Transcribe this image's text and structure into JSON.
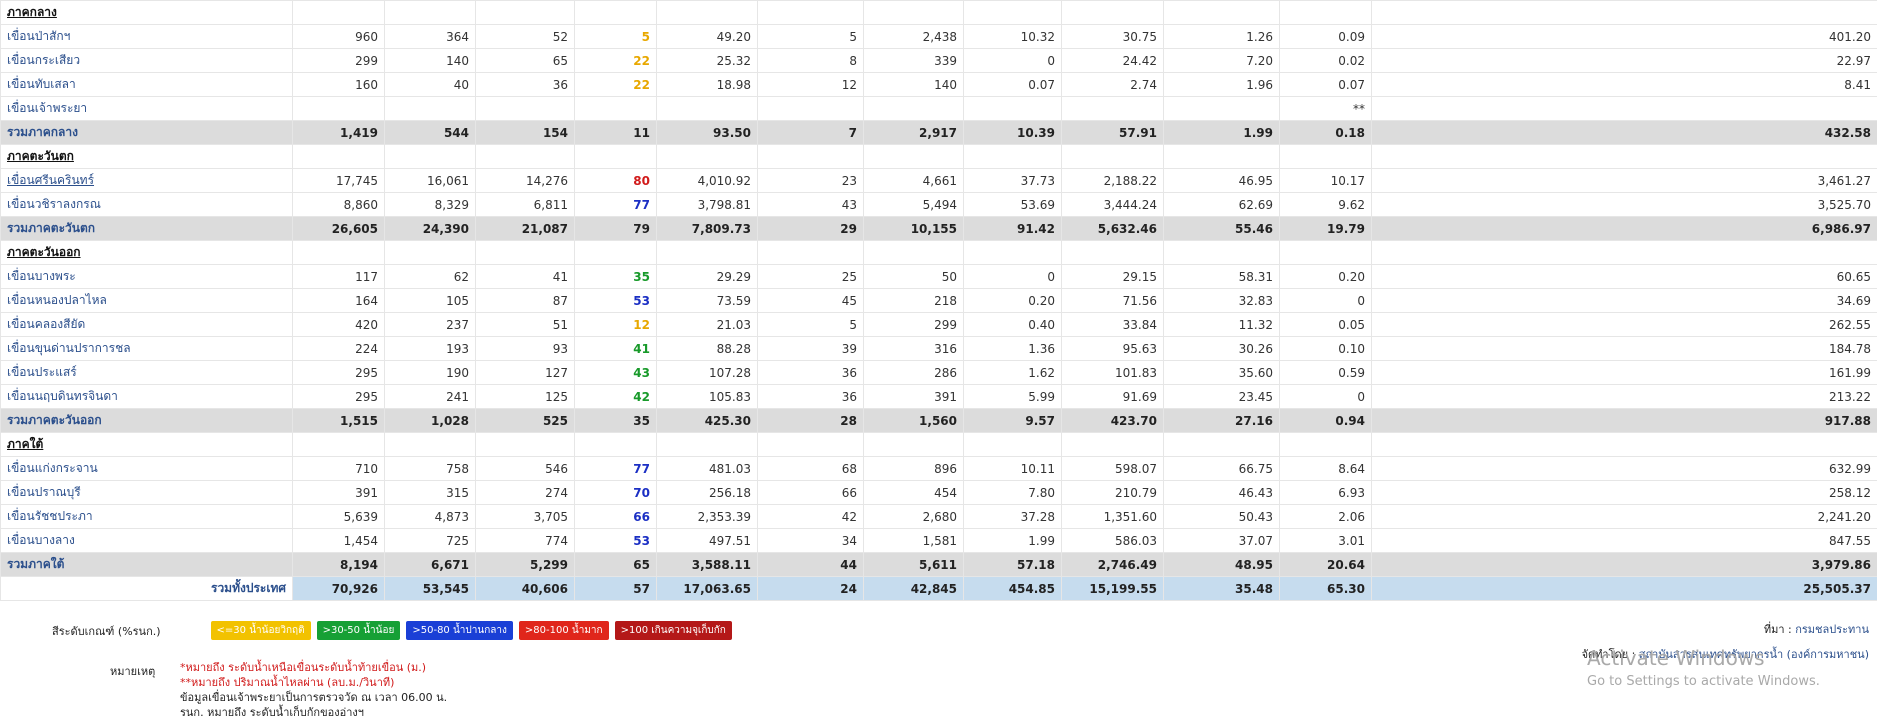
{
  "rows": [
    {
      "type": "region",
      "name": "ภาคกลาง"
    },
    {
      "type": "dam",
      "name": "เขื่อนป่าสักฯ",
      "c": [
        "960",
        "364",
        "52",
        "5",
        "49.20",
        "5",
        "2,438",
        "10.32",
        "30.75",
        "1.26",
        "0.09",
        "401.20"
      ],
      "pc": "yellow"
    },
    {
      "type": "dam",
      "name": "เขื่อนกระเสียว",
      "c": [
        "299",
        "140",
        "65",
        "22",
        "25.32",
        "8",
        "339",
        "0",
        "24.42",
        "7.20",
        "0.02",
        "22.97"
      ],
      "pc": "yellow"
    },
    {
      "type": "dam",
      "name": "เขื่อนทับเสลา",
      "c": [
        "160",
        "40",
        "36",
        "22",
        "18.98",
        "12",
        "140",
        "0.07",
        "2.74",
        "1.96",
        "0.07",
        "8.41"
      ],
      "pc": "yellow"
    },
    {
      "type": "dam",
      "name": "เขื่อนเจ้าพระยา",
      "c": [
        "",
        "",
        "",
        "",
        "",
        "",
        "",
        "",
        "",
        "",
        "**",
        ""
      ],
      "pc": "",
      "star": true
    },
    {
      "type": "total",
      "name": "รวมภาคกลาง",
      "c": [
        "1,419",
        "544",
        "154",
        "11",
        "93.50",
        "7",
        "2,917",
        "10.39",
        "57.91",
        "1.99",
        "0.18",
        "432.58"
      ]
    },
    {
      "type": "region",
      "name": "ภาคตะวันตก"
    },
    {
      "type": "dam",
      "name": "เขื่อนศรีนครินทร์",
      "c": [
        "17,745",
        "16,061",
        "14,276",
        "80",
        "4,010.92",
        "23",
        "4,661",
        "37.73",
        "2,188.22",
        "46.95",
        "10.17",
        "3,461.27"
      ],
      "pc": "red",
      "ul": true
    },
    {
      "type": "dam",
      "name": "เขื่อนวชิราลงกรณ",
      "c": [
        "8,860",
        "8,329",
        "6,811",
        "77",
        "3,798.81",
        "43",
        "5,494",
        "53.69",
        "3,444.24",
        "62.69",
        "9.62",
        "3,525.70"
      ],
      "pc": "blue"
    },
    {
      "type": "total",
      "name": "รวมภาคตะวันตก",
      "c": [
        "26,605",
        "24,390",
        "21,087",
        "79",
        "7,809.73",
        "29",
        "10,155",
        "91.42",
        "5,632.46",
        "55.46",
        "19.79",
        "6,986.97"
      ]
    },
    {
      "type": "region",
      "name": "ภาคตะวันออก"
    },
    {
      "type": "dam",
      "name": "เขื่อนบางพระ",
      "c": [
        "117",
        "62",
        "41",
        "35",
        "29.29",
        "25",
        "50",
        "0",
        "29.15",
        "58.31",
        "0.20",
        "60.65"
      ],
      "pc": "green"
    },
    {
      "type": "dam",
      "name": "เขื่อนหนองปลาไหล",
      "c": [
        "164",
        "105",
        "87",
        "53",
        "73.59",
        "45",
        "218",
        "0.20",
        "71.56",
        "32.83",
        "0",
        "34.69"
      ],
      "pc": "blue"
    },
    {
      "type": "dam",
      "name": "เขื่อนคลองสียัด",
      "c": [
        "420",
        "237",
        "51",
        "12",
        "21.03",
        "5",
        "299",
        "0.40",
        "33.84",
        "11.32",
        "0.05",
        "262.55"
      ],
      "pc": "yellow"
    },
    {
      "type": "dam",
      "name": "เขื่อนขุนด่านปราการชล",
      "c": [
        "224",
        "193",
        "93",
        "41",
        "88.28",
        "39",
        "316",
        "1.36",
        "95.63",
        "30.26",
        "0.10",
        "184.78"
      ],
      "pc": "green"
    },
    {
      "type": "dam",
      "name": "เขื่อนประแสร์",
      "c": [
        "295",
        "190",
        "127",
        "43",
        "107.28",
        "36",
        "286",
        "1.62",
        "101.83",
        "35.60",
        "0.59",
        "161.99"
      ],
      "pc": "green"
    },
    {
      "type": "dam",
      "name": "เขื่อนนฤบดินทรจินดา",
      "c": [
        "295",
        "241",
        "125",
        "42",
        "105.83",
        "36",
        "391",
        "5.99",
        "91.69",
        "23.45",
        "0",
        "213.22"
      ],
      "pc": "green"
    },
    {
      "type": "total",
      "name": "รวมภาคตะวันออก",
      "c": [
        "1,515",
        "1,028",
        "525",
        "35",
        "425.30",
        "28",
        "1,560",
        "9.57",
        "423.70",
        "27.16",
        "0.94",
        "917.88"
      ]
    },
    {
      "type": "region",
      "name": "ภาคใต้"
    },
    {
      "type": "dam",
      "name": "เขื่อนแก่งกระจาน",
      "c": [
        "710",
        "758",
        "546",
        "77",
        "481.03",
        "68",
        "896",
        "10.11",
        "598.07",
        "66.75",
        "8.64",
        "632.99"
      ],
      "pc": "blue"
    },
    {
      "type": "dam",
      "name": "เขื่อนปราณบุรี",
      "c": [
        "391",
        "315",
        "274",
        "70",
        "256.18",
        "66",
        "454",
        "7.80",
        "210.79",
        "46.43",
        "6.93",
        "258.12"
      ],
      "pc": "blue"
    },
    {
      "type": "dam",
      "name": "เขื่อนรัชชประภา",
      "c": [
        "5,639",
        "4,873",
        "3,705",
        "66",
        "2,353.39",
        "42",
        "2,680",
        "37.28",
        "1,351.60",
        "50.43",
        "2.06",
        "2,241.20"
      ],
      "pc": "blue"
    },
    {
      "type": "dam",
      "name": "เขื่อนบางลาง",
      "c": [
        "1,454",
        "725",
        "774",
        "53",
        "497.51",
        "34",
        "1,581",
        "1.99",
        "586.03",
        "37.07",
        "3.01",
        "847.55"
      ],
      "pc": "blue"
    },
    {
      "type": "total",
      "name": "รวมภาคใต้",
      "c": [
        "8,194",
        "6,671",
        "5,299",
        "65",
        "3,588.11",
        "44",
        "5,611",
        "57.18",
        "2,746.49",
        "48.95",
        "20.64",
        "3,979.86"
      ]
    },
    {
      "type": "grand",
      "name": "รวมทั้งประเทศ",
      "c": [
        "70,926",
        "53,545",
        "40,606",
        "57",
        "17,063.65",
        "24",
        "42,845",
        "454.85",
        "15,199.55",
        "35.48",
        "65.30",
        "25,505.37"
      ]
    }
  ],
  "legend": {
    "label": "สีระดับเกณฑ์ (%รนก.)",
    "items": [
      {
        "text": "<=30 น้ำน้อยวิกฤติ",
        "cls": "b-y"
      },
      {
        "text": ">30-50 น้ำน้อย",
        "cls": "b-g"
      },
      {
        "text": ">50-80 น้ำปานกลาง",
        "cls": "b-b"
      },
      {
        "text": ">80-100 น้ำมาก",
        "cls": "b-r"
      },
      {
        "text": ">100 เกินความจุเก็บกัก",
        "cls": "b-dr"
      }
    ]
  },
  "notes": {
    "title": "หมายเหตุ",
    "line1": "*หมายถึง ระดับน้ำเหนือเขื่อนระดับน้ำท้ายเขื่อน (ม.)",
    "line2": "**หมายถึง ปริมาณน้ำไหลผ่าน (ลบ.ม./วินาที)",
    "line3": "ข้อมูลเขื่อนเจ้าพระยาเป็นการตรวจวัด ณ เวลา 06.00 น.",
    "line4": "รนก. หมายถึง ระดับน้ำเก็บกักของอ่างฯ"
  },
  "source": {
    "label": "ที่มา : ",
    "value": "กรมชลประทาน"
  },
  "prepared": {
    "label": "จัดทำโดย : ",
    "value": "สถาบันสารสนเทศทรัพยากรน้ำ (องค์การมหาชน)"
  },
  "activate": {
    "title": "Activate Windows",
    "sub": "Go to Settings to activate Windows."
  }
}
